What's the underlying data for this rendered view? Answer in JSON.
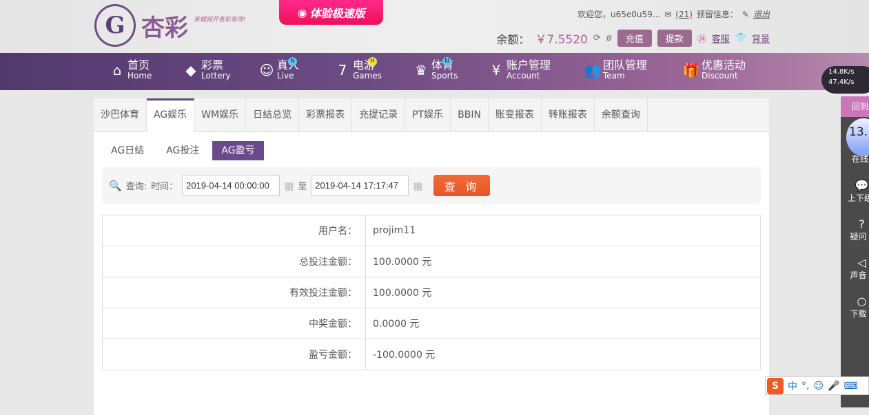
{
  "header": {
    "logo_text": "杏彩",
    "slogan": "来城就开杏彩有你!",
    "speed_button": "体验极速版",
    "welcome": "欢迎您，u65e0u59...",
    "mail_count": "(21)",
    "reserve_info": "预留信息：",
    "logout": "退出",
    "balance_label": "余额：",
    "balance": "￥7.5520",
    "recharge": "充值",
    "withdraw": "提款",
    "service": "客服",
    "background": "背景"
  },
  "nav": [
    {
      "zh": "首页",
      "en": "Home",
      "icon": "home-icon"
    },
    {
      "zh": "彩票",
      "en": "Lottery",
      "icon": "ticket-icon"
    },
    {
      "zh": "真人",
      "en": "Live",
      "icon": "dealer-icon",
      "badge": "N"
    },
    {
      "zh": "电游",
      "en": "Games",
      "icon": "seven-icon",
      "badge": "H"
    },
    {
      "zh": "体育",
      "en": "Sports",
      "icon": "trophy-icon",
      "badge": "N"
    },
    {
      "zh": "账户管理",
      "en": "Account",
      "icon": "yen-icon"
    },
    {
      "zh": "团队管理",
      "en": "Team",
      "icon": "team-icon"
    },
    {
      "zh": "优惠活动",
      "en": "Discount",
      "icon": "gift-icon"
    }
  ],
  "speed": {
    "up": "14.8K/s",
    "down": "47.4K/s"
  },
  "tabs": [
    "沙巴体育",
    "AG娱乐",
    "WM娱乐",
    "日结总览",
    "彩票报表",
    "充提记录",
    "PT娱乐",
    "BBIN",
    "账变报表",
    "转账报表",
    "余额查询"
  ],
  "subtabs": [
    "AG日结",
    "AG投注",
    "AG盈亏"
  ],
  "query": {
    "label": "查询:",
    "time_label": "时间：",
    "start": "2019-04-14 00:00:00",
    "to": "至",
    "end": "2019-04-14 17:17:47",
    "button": "查 询"
  },
  "rows": [
    {
      "label": "用户名：",
      "value": "projim11"
    },
    {
      "label": "总投注金额：",
      "value": "100.0000 元"
    },
    {
      "label": "有效投注金额：",
      "value": "100.0000 元"
    },
    {
      "label": "中奖金额：",
      "value": "0.0000 元"
    },
    {
      "label": "盈亏金额：",
      "value": "-100.0000 元"
    }
  ],
  "side": {
    "top": "回到",
    "online_value": "13.",
    "online_label": "在线",
    "items": [
      "上下级",
      "疑问",
      "声音",
      "下载"
    ]
  },
  "ime": {
    "lang": "中"
  }
}
